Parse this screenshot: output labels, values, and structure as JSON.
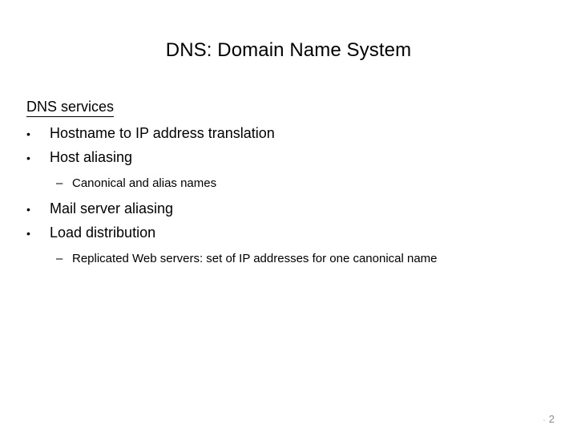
{
  "slide": {
    "title": "DNS: Domain Name System",
    "heading": "DNS services",
    "bullets": [
      {
        "marker": "•",
        "text": "Hostname to IP address translation",
        "sub": []
      },
      {
        "marker": "•",
        "text": "Host aliasing",
        "sub": [
          {
            "marker": "–",
            "text": "Canonical and alias names"
          }
        ]
      },
      {
        "marker": "•",
        "text": "Mail server aliasing",
        "sub": []
      },
      {
        "marker": "•",
        "text": "Load distribution",
        "sub": [
          {
            "marker": "–",
            "text": "Replicated Web servers: set of IP addresses for one canonical name"
          }
        ]
      }
    ],
    "page_number": "2"
  }
}
